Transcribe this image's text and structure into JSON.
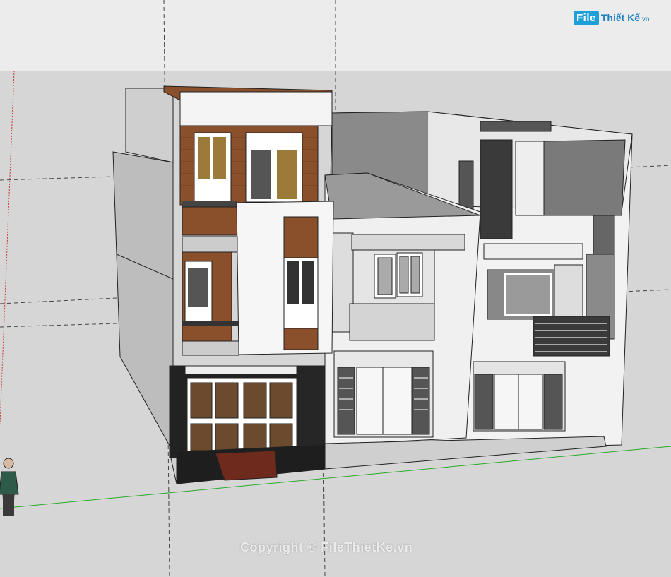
{
  "app": {
    "watermark_text": "Copyright © FileThietKe.vn",
    "logo": {
      "badge": "File",
      "name": "Thiết Kế",
      "suffix": ".vn"
    }
  },
  "colors": {
    "sky": "#ececec",
    "ground": "#d6d6d6",
    "wood": "#8a4f2b",
    "white_wall": "#f4f4f4",
    "grey_wall": "#a8a8a8",
    "dark": "#2a2a2a",
    "axis_green": "#2aa82a",
    "axis_red": "#c0392b",
    "logo_blue": "#1e9fd8"
  },
  "scene": {
    "model": "3-storey townhouse with neighbouring houses",
    "figure": "scale-figure"
  }
}
